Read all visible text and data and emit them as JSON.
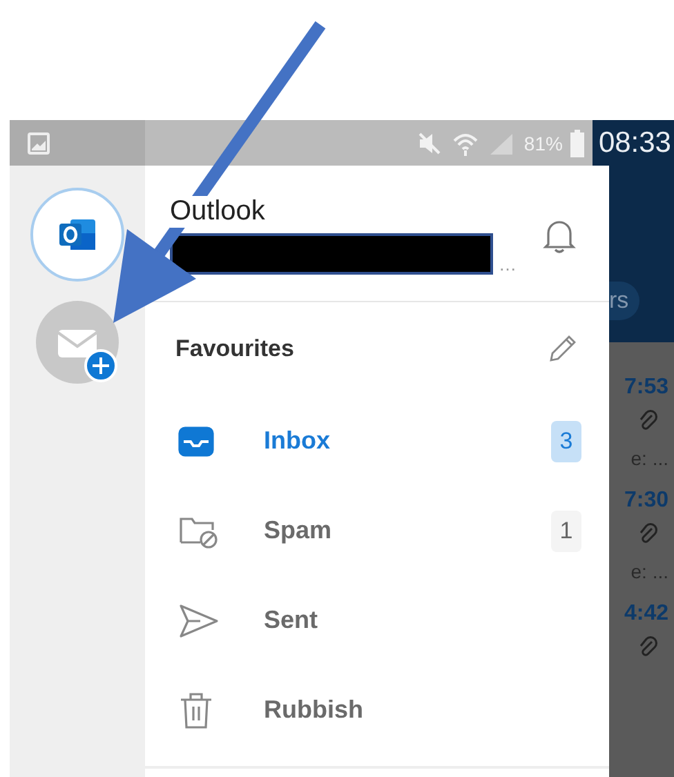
{
  "status_bar": {
    "battery": "81%",
    "time": "08:33"
  },
  "account": {
    "title": "Outlook",
    "email_tail": "…"
  },
  "favourites": {
    "title": "Favourites"
  },
  "folders": [
    {
      "kind": "inbox",
      "label": "Inbox",
      "count": "3",
      "selected": true
    },
    {
      "kind": "spam",
      "label": "Spam",
      "count": "1",
      "selected": false
    },
    {
      "kind": "sent",
      "label": "Sent",
      "selected": false
    },
    {
      "kind": "rubbish",
      "label": "Rubbish",
      "selected": false
    }
  ],
  "background": {
    "button": "rs",
    "items": [
      {
        "kind": "time",
        "text": "7:53"
      },
      {
        "kind": "preview",
        "text": "e: ..."
      },
      {
        "kind": "time",
        "text": "7:30"
      },
      {
        "kind": "preview",
        "text": "e: ..."
      },
      {
        "kind": "time",
        "text": "4:42"
      }
    ]
  }
}
